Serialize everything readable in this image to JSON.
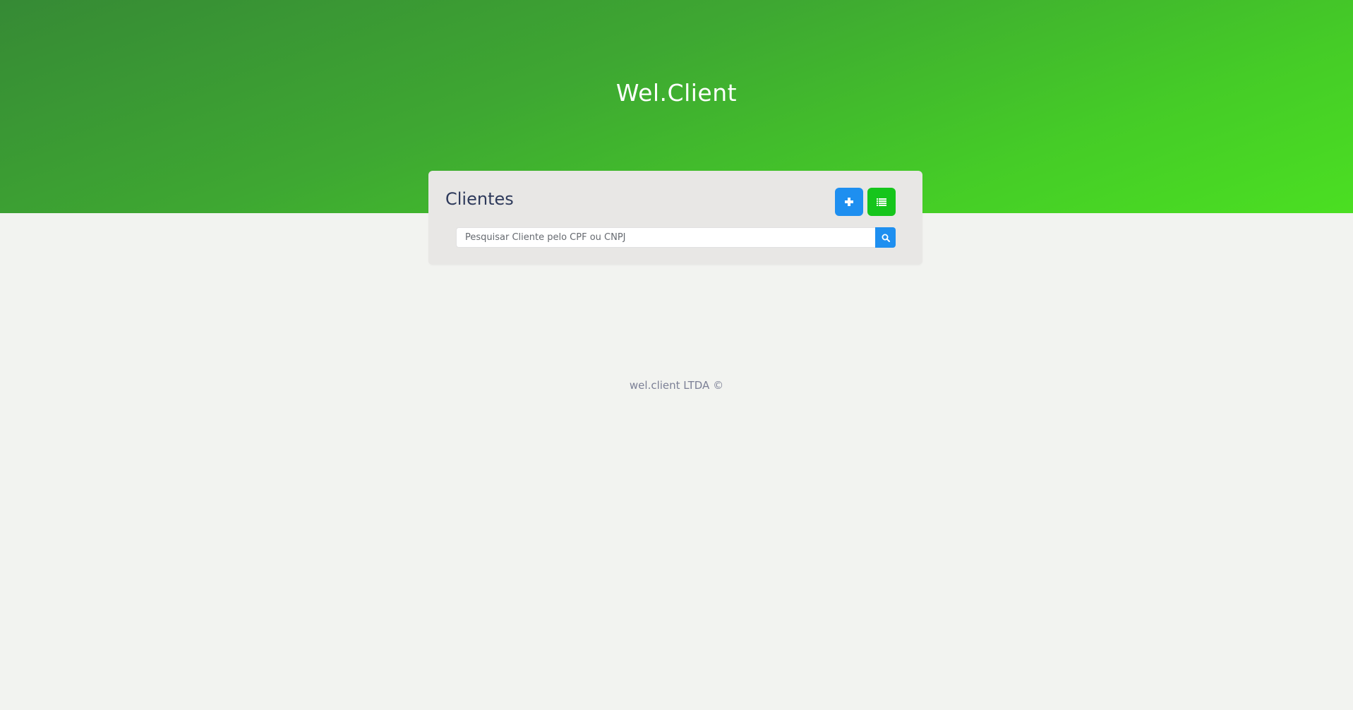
{
  "header": {
    "app_title": "Wel.Client"
  },
  "clients_card": {
    "title": "Clientes",
    "add_button_icon": "plus-icon",
    "list_button_icon": "list-icon",
    "search": {
      "placeholder": "Pesquisar Cliente pelo CPF ou CNPJ",
      "value": "",
      "button_icon": "search-icon"
    }
  },
  "footer": {
    "text": "wel.client LTDA ©"
  },
  "colors": {
    "hero_gradient_start": "#368a35",
    "hero_gradient_end": "#4bdf22",
    "primary_blue": "#1e8ff0",
    "success_green": "#16c51c",
    "card_background": "#e8e7e5",
    "page_background": "#f2f3f0",
    "title_text": "#2e3a5b"
  }
}
